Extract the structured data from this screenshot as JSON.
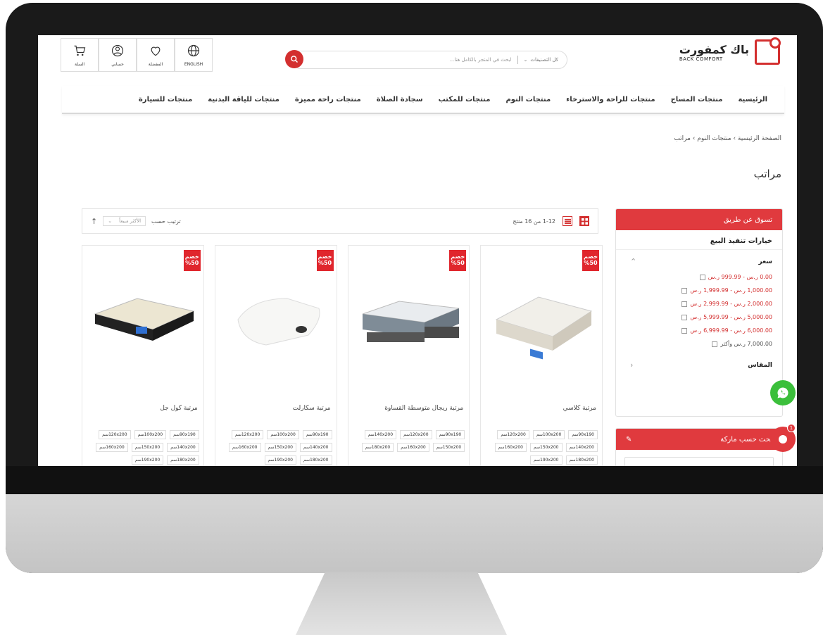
{
  "brand": {
    "name_ar": "باك كمفورت",
    "name_en": "BACK COMFORT"
  },
  "header": {
    "search_placeholder": "ابحث في المتجر بالكامل هنا...",
    "category_select": "كل التصنيفات",
    "icons": [
      {
        "name": "english",
        "label": "ENGLISH"
      },
      {
        "name": "wishlist",
        "label": "المفضلة"
      },
      {
        "name": "account",
        "label": "حسابي"
      },
      {
        "name": "cart",
        "label": "السلة"
      }
    ]
  },
  "nav": [
    "الرئيسية",
    "منتجات المساج",
    "منتجات للراحة والاسترخاء",
    "منتجات النوم",
    "منتجات للمكتب",
    "سجادة الصلاة",
    "منتجات راحة مميزة",
    "منتجات للياقة البدنية",
    "منتجات للسيارة"
  ],
  "breadcrumb": "الصفحة الرئيسية › منتجات النوم › مراتب",
  "page_title": "مراتب",
  "sidebar": {
    "shop_by": "تسوق عن طريق",
    "sale_options": "خيارات تنفيذ البيع",
    "price_heading": "سعر",
    "prices": [
      "0.00 ر.س - 999.99 ر.س",
      "1,000.00 ر.س - 1,999.99 ر.س",
      "2,000.00 ر.س - 2,999.99 ر.س",
      "5,000.00 ر.س - 5,999.99 ر.س",
      "6,000.00 ر.س - 6,999.99 ر.س",
      "7,000.00 ر.س وأكثر"
    ],
    "more_heading": "المقاس",
    "brand_search": "بحث حسب ماركة"
  },
  "toolbar": {
    "count": "1-12 من 16 منتج",
    "sort_label": "ترتيب حسب",
    "sort_value": "الأكثر مبيعاً"
  },
  "badge": {
    "line1": "خصم",
    "line2": "%50"
  },
  "products": [
    {
      "name": "مرتبة كلاسي",
      "sizes": [
        "90x190سم",
        "100x200سم",
        "120x200سم",
        "140x200سم",
        "150x200سم",
        "160x200سم",
        "180x200سم",
        "190x200سم"
      ]
    },
    {
      "name": "مرتبة ريجال متوسطة القساوة",
      "sizes": [
        "90x190سم",
        "120x200سم",
        "140x200سم",
        "150x200سم",
        "160x200سم",
        "180x200سم"
      ]
    },
    {
      "name": "مرتبة سكارلت",
      "sizes": [
        "90x190سم",
        "100x200سم",
        "120x200سم",
        "140x200سم",
        "150x200سم",
        "160x200سم",
        "180x200سم",
        "190x200سم"
      ]
    },
    {
      "name": "مرتبة كول جل",
      "sizes": [
        "90x190سم",
        "100x200سم",
        "120x200سم",
        "140x200سم",
        "150x200سم",
        "160x200سم",
        "180x200سم",
        "190x200سم"
      ]
    }
  ],
  "colors": {
    "brand_red": "#e03a3e",
    "whatsapp": "#3bbf3b"
  }
}
